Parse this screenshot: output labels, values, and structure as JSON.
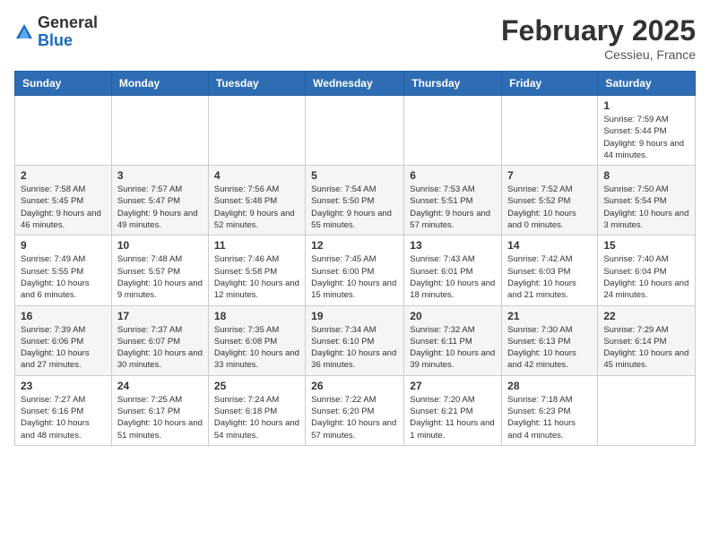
{
  "header": {
    "logo": {
      "general": "General",
      "blue": "Blue"
    },
    "month_year": "February 2025",
    "location": "Cessieu, France"
  },
  "weekdays": [
    "Sunday",
    "Monday",
    "Tuesday",
    "Wednesday",
    "Thursday",
    "Friday",
    "Saturday"
  ],
  "weeks": [
    [
      null,
      null,
      null,
      null,
      null,
      null,
      {
        "day": "1",
        "sunrise": "7:59 AM",
        "sunset": "5:44 PM",
        "daylight": "9 hours and 44 minutes."
      }
    ],
    [
      {
        "day": "2",
        "sunrise": "7:58 AM",
        "sunset": "5:45 PM",
        "daylight": "9 hours and 46 minutes."
      },
      {
        "day": "3",
        "sunrise": "7:57 AM",
        "sunset": "5:47 PM",
        "daylight": "9 hours and 49 minutes."
      },
      {
        "day": "4",
        "sunrise": "7:56 AM",
        "sunset": "5:48 PM",
        "daylight": "9 hours and 52 minutes."
      },
      {
        "day": "5",
        "sunrise": "7:54 AM",
        "sunset": "5:50 PM",
        "daylight": "9 hours and 55 minutes."
      },
      {
        "day": "6",
        "sunrise": "7:53 AM",
        "sunset": "5:51 PM",
        "daylight": "9 hours and 57 minutes."
      },
      {
        "day": "7",
        "sunrise": "7:52 AM",
        "sunset": "5:52 PM",
        "daylight": "10 hours and 0 minutes."
      },
      {
        "day": "8",
        "sunrise": "7:50 AM",
        "sunset": "5:54 PM",
        "daylight": "10 hours and 3 minutes."
      }
    ],
    [
      {
        "day": "9",
        "sunrise": "7:49 AM",
        "sunset": "5:55 PM",
        "daylight": "10 hours and 6 minutes."
      },
      {
        "day": "10",
        "sunrise": "7:48 AM",
        "sunset": "5:57 PM",
        "daylight": "10 hours and 9 minutes."
      },
      {
        "day": "11",
        "sunrise": "7:46 AM",
        "sunset": "5:58 PM",
        "daylight": "10 hours and 12 minutes."
      },
      {
        "day": "12",
        "sunrise": "7:45 AM",
        "sunset": "6:00 PM",
        "daylight": "10 hours and 15 minutes."
      },
      {
        "day": "13",
        "sunrise": "7:43 AM",
        "sunset": "6:01 PM",
        "daylight": "10 hours and 18 minutes."
      },
      {
        "day": "14",
        "sunrise": "7:42 AM",
        "sunset": "6:03 PM",
        "daylight": "10 hours and 21 minutes."
      },
      {
        "day": "15",
        "sunrise": "7:40 AM",
        "sunset": "6:04 PM",
        "daylight": "10 hours and 24 minutes."
      }
    ],
    [
      {
        "day": "16",
        "sunrise": "7:39 AM",
        "sunset": "6:06 PM",
        "daylight": "10 hours and 27 minutes."
      },
      {
        "day": "17",
        "sunrise": "7:37 AM",
        "sunset": "6:07 PM",
        "daylight": "10 hours and 30 minutes."
      },
      {
        "day": "18",
        "sunrise": "7:35 AM",
        "sunset": "6:08 PM",
        "daylight": "10 hours and 33 minutes."
      },
      {
        "day": "19",
        "sunrise": "7:34 AM",
        "sunset": "6:10 PM",
        "daylight": "10 hours and 36 minutes."
      },
      {
        "day": "20",
        "sunrise": "7:32 AM",
        "sunset": "6:11 PM",
        "daylight": "10 hours and 39 minutes."
      },
      {
        "day": "21",
        "sunrise": "7:30 AM",
        "sunset": "6:13 PM",
        "daylight": "10 hours and 42 minutes."
      },
      {
        "day": "22",
        "sunrise": "7:29 AM",
        "sunset": "6:14 PM",
        "daylight": "10 hours and 45 minutes."
      }
    ],
    [
      {
        "day": "23",
        "sunrise": "7:27 AM",
        "sunset": "6:16 PM",
        "daylight": "10 hours and 48 minutes."
      },
      {
        "day": "24",
        "sunrise": "7:25 AM",
        "sunset": "6:17 PM",
        "daylight": "10 hours and 51 minutes."
      },
      {
        "day": "25",
        "sunrise": "7:24 AM",
        "sunset": "6:18 PM",
        "daylight": "10 hours and 54 minutes."
      },
      {
        "day": "26",
        "sunrise": "7:22 AM",
        "sunset": "6:20 PM",
        "daylight": "10 hours and 57 minutes."
      },
      {
        "day": "27",
        "sunrise": "7:20 AM",
        "sunset": "6:21 PM",
        "daylight": "11 hours and 1 minute."
      },
      {
        "day": "28",
        "sunrise": "7:18 AM",
        "sunset": "6:23 PM",
        "daylight": "11 hours and 4 minutes."
      },
      null
    ]
  ]
}
